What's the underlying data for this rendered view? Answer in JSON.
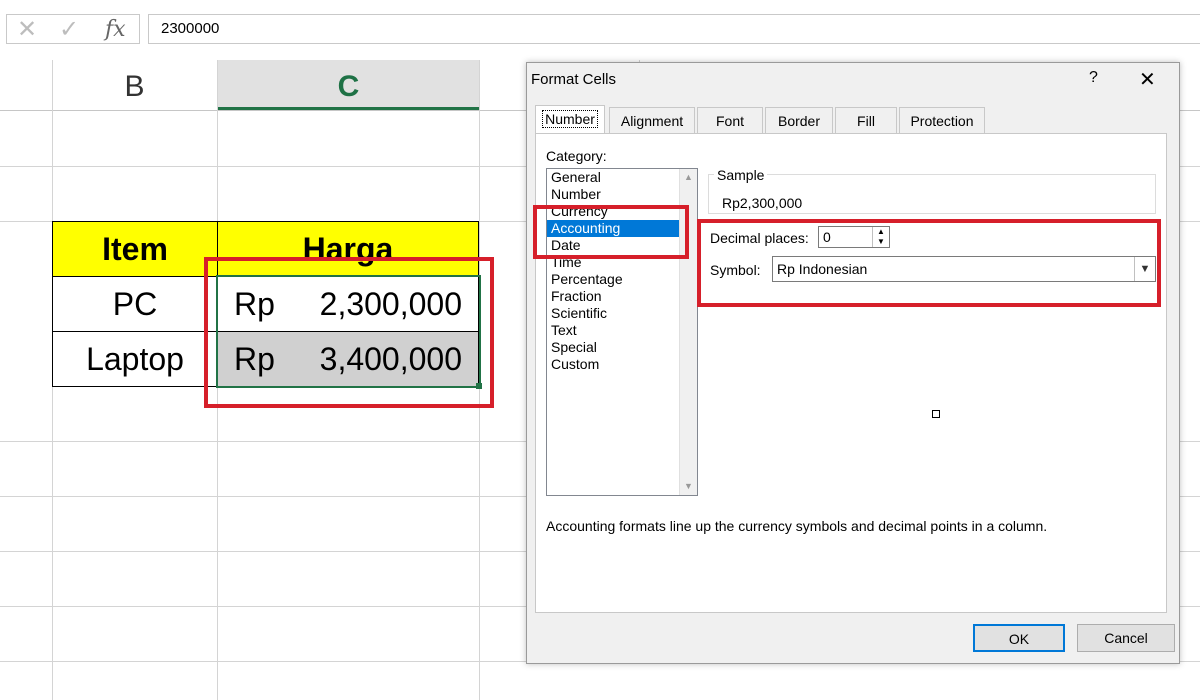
{
  "formula_bar": {
    "cancel_icon": "x-icon",
    "enter_icon": "check-icon",
    "fx_label": "fx",
    "value": "2300000"
  },
  "columns": [
    "B",
    "C"
  ],
  "table": {
    "headers": [
      "Item",
      "Harga"
    ],
    "rows": [
      {
        "item": "PC",
        "symbol": "Rp",
        "amount": "2,300,000"
      },
      {
        "item": "Laptop",
        "symbol": "Rp",
        "amount": "3,400,000"
      }
    ]
  },
  "dialog": {
    "title": "Format Cells",
    "help": "?",
    "close": "✕",
    "tabs": [
      "Number",
      "Alignment",
      "Font",
      "Border",
      "Fill",
      "Protection"
    ],
    "category_label": "Category:",
    "categories": [
      "General",
      "Number",
      "Currency",
      "Accounting",
      "Date",
      "Time",
      "Percentage",
      "Fraction",
      "Scientific",
      "Text",
      "Special",
      "Custom"
    ],
    "selected_category": "Accounting",
    "sample_label": "Sample",
    "sample_value": "Rp2,300,000",
    "decimal_label": "Decimal places:",
    "decimal_value": "0",
    "symbol_label": "Symbol:",
    "symbol_value": "Rp Indonesian",
    "description": "Accounting formats line up the currency symbols and decimal points in a column.",
    "ok": "OK",
    "cancel": "Cancel"
  },
  "colors": {
    "header_fill": "#ffff00",
    "excel_green": "#217346",
    "selection_blue": "#0078d7",
    "highlight_red": "#d61f2a"
  }
}
